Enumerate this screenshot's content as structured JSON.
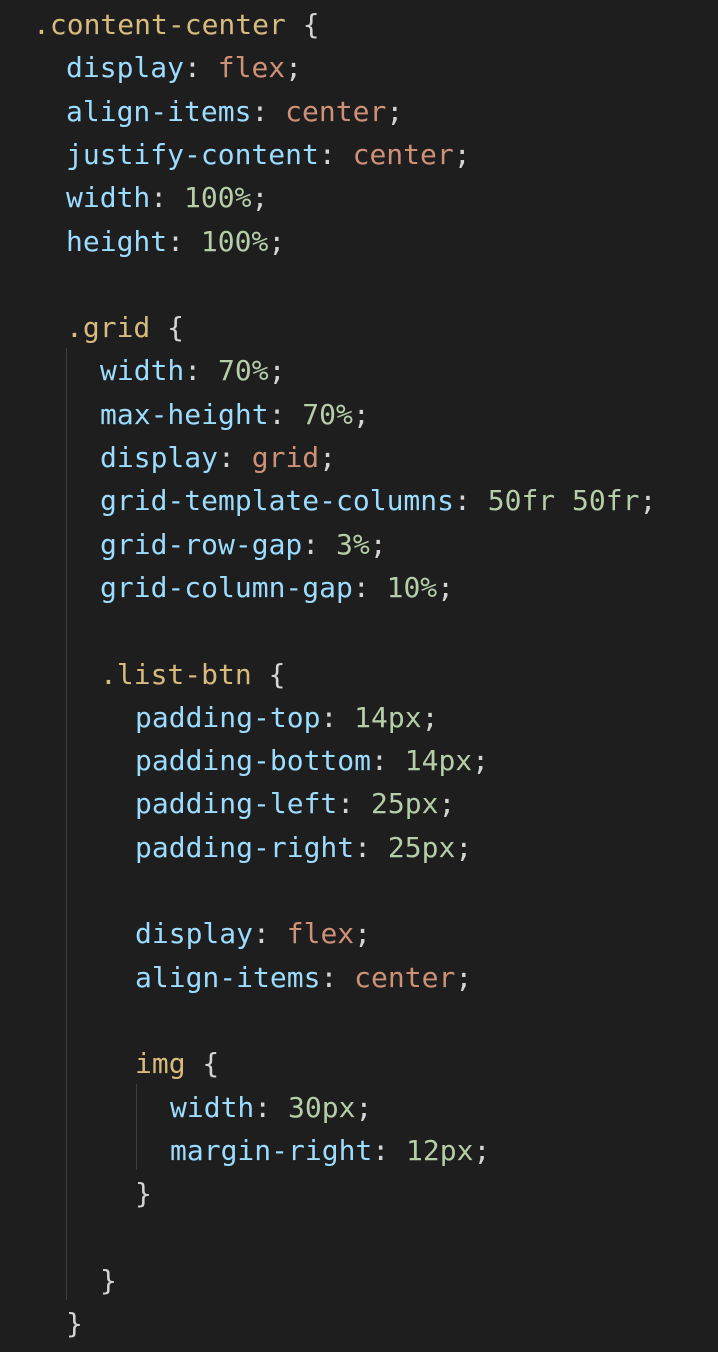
{
  "editor": {
    "lines": [
      [
        {
          "t": ".content-center",
          "c": "selector"
        },
        {
          "t": " {",
          "c": "punct"
        }
      ],
      [
        {
          "t": "display",
          "c": "prop"
        },
        {
          "t": ": ",
          "c": "punct"
        },
        {
          "t": "flex",
          "c": "kw"
        },
        {
          "t": ";",
          "c": "punct"
        }
      ],
      [
        {
          "t": "align-items",
          "c": "prop"
        },
        {
          "t": ": ",
          "c": "punct"
        },
        {
          "t": "center",
          "c": "kw"
        },
        {
          "t": ";",
          "c": "punct"
        }
      ],
      [
        {
          "t": "justify-content",
          "c": "prop"
        },
        {
          "t": ": ",
          "c": "punct"
        },
        {
          "t": "center",
          "c": "kw"
        },
        {
          "t": ";",
          "c": "punct"
        }
      ],
      [
        {
          "t": "width",
          "c": "prop"
        },
        {
          "t": ": ",
          "c": "punct"
        },
        {
          "t": "100%",
          "c": "num"
        },
        {
          "t": ";",
          "c": "punct"
        }
      ],
      [
        {
          "t": "height",
          "c": "prop"
        },
        {
          "t": ": ",
          "c": "punct"
        },
        {
          "t": "100%",
          "c": "num"
        },
        {
          "t": ";",
          "c": "punct"
        }
      ],
      [],
      [
        {
          "t": ".grid",
          "c": "selector"
        },
        {
          "t": " {",
          "c": "punct"
        }
      ],
      [
        {
          "t": "width",
          "c": "prop"
        },
        {
          "t": ": ",
          "c": "punct"
        },
        {
          "t": "70%",
          "c": "num"
        },
        {
          "t": ";",
          "c": "punct"
        }
      ],
      [
        {
          "t": "max-height",
          "c": "prop"
        },
        {
          "t": ": ",
          "c": "punct"
        },
        {
          "t": "70%",
          "c": "num"
        },
        {
          "t": ";",
          "c": "punct"
        }
      ],
      [
        {
          "t": "display",
          "c": "prop"
        },
        {
          "t": ": ",
          "c": "punct"
        },
        {
          "t": "grid",
          "c": "kw"
        },
        {
          "t": ";",
          "c": "punct"
        }
      ],
      [
        {
          "t": "grid-template-columns",
          "c": "prop"
        },
        {
          "t": ": ",
          "c": "punct"
        },
        {
          "t": "50fr",
          "c": "num"
        },
        {
          "t": " ",
          "c": "punct"
        },
        {
          "t": "50fr",
          "c": "num"
        },
        {
          "t": ";",
          "c": "punct"
        }
      ],
      [
        {
          "t": "grid-row-gap",
          "c": "prop"
        },
        {
          "t": ": ",
          "c": "punct"
        },
        {
          "t": "3%",
          "c": "num"
        },
        {
          "t": ";",
          "c": "punct"
        }
      ],
      [
        {
          "t": "grid-column-gap",
          "c": "prop"
        },
        {
          "t": ": ",
          "c": "punct"
        },
        {
          "t": "10%",
          "c": "num"
        },
        {
          "t": ";",
          "c": "punct"
        }
      ],
      [],
      [
        {
          "t": ".list-btn",
          "c": "selector"
        },
        {
          "t": " {",
          "c": "punct"
        }
      ],
      [
        {
          "t": "padding-top",
          "c": "prop"
        },
        {
          "t": ": ",
          "c": "punct"
        },
        {
          "t": "14px",
          "c": "num"
        },
        {
          "t": ";",
          "c": "punct"
        }
      ],
      [
        {
          "t": "padding-bottom",
          "c": "prop"
        },
        {
          "t": ": ",
          "c": "punct"
        },
        {
          "t": "14px",
          "c": "num"
        },
        {
          "t": ";",
          "c": "punct"
        }
      ],
      [
        {
          "t": "padding-left",
          "c": "prop"
        },
        {
          "t": ": ",
          "c": "punct"
        },
        {
          "t": "25px",
          "c": "num"
        },
        {
          "t": ";",
          "c": "punct"
        }
      ],
      [
        {
          "t": "padding-right",
          "c": "prop"
        },
        {
          "t": ": ",
          "c": "punct"
        },
        {
          "t": "25px",
          "c": "num"
        },
        {
          "t": ";",
          "c": "punct"
        }
      ],
      [],
      [
        {
          "t": "display",
          "c": "prop"
        },
        {
          "t": ": ",
          "c": "punct"
        },
        {
          "t": "flex",
          "c": "kw"
        },
        {
          "t": ";",
          "c": "punct"
        }
      ],
      [
        {
          "t": "align-items",
          "c": "prop"
        },
        {
          "t": ": ",
          "c": "punct"
        },
        {
          "t": "center",
          "c": "kw"
        },
        {
          "t": ";",
          "c": "punct"
        }
      ],
      [],
      [
        {
          "t": "img",
          "c": "selector"
        },
        {
          "t": " {",
          "c": "punct"
        }
      ],
      [
        {
          "t": "width",
          "c": "prop"
        },
        {
          "t": ": ",
          "c": "punct"
        },
        {
          "t": "30px",
          "c": "num"
        },
        {
          "t": ";",
          "c": "punct"
        }
      ],
      [
        {
          "t": "margin-right",
          "c": "prop"
        },
        {
          "t": ": ",
          "c": "punct"
        },
        {
          "t": "12px",
          "c": "num"
        },
        {
          "t": ";",
          "c": "punct"
        }
      ],
      [
        {
          "t": "}",
          "c": "punct"
        }
      ],
      [],
      [
        {
          "t": "}",
          "c": "punct"
        }
      ],
      [
        {
          "t": "}",
          "c": "punct"
        }
      ]
    ]
  },
  "colors": {
    "background": "#1e1e1e",
    "selector": "#d7ba7d",
    "property": "#9cdcfe",
    "keyword_value": "#ce9178",
    "numeric_value": "#b5cea8",
    "punctuation": "#d4d4d4",
    "indent_guide": "#3f3f3f"
  }
}
